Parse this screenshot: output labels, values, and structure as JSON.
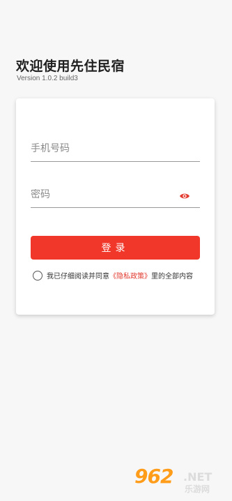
{
  "header": {
    "title": "欢迎使用先住民宿",
    "version": "Version 1.0.2 build3"
  },
  "form": {
    "phone_placeholder": "手机号码",
    "password_placeholder": "密码",
    "login_label": "登录",
    "agreement_prefix": "我已仔细阅读并同意",
    "agreement_link": "《隐私政策》",
    "agreement_suffix": "里的全部内容"
  },
  "icons": {
    "password_toggle": "eye-icon",
    "agreement_radio": "radio-unchecked-icon"
  },
  "watermark": {
    "number": "962",
    "net": ".NET",
    "site": "乐游网"
  },
  "colors": {
    "accent": "#f1372a",
    "link": "#e23a2f",
    "background": "#f7f7f7"
  }
}
